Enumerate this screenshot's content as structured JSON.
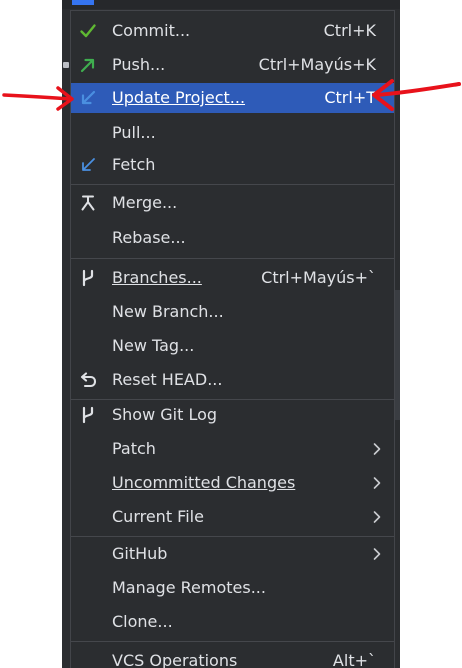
{
  "menu": {
    "items": [
      {
        "label": "Commit...",
        "shortcut": "Ctrl+K",
        "icon": "check-icon"
      },
      {
        "label": "Push...",
        "shortcut": "Ctrl+Mayús+K",
        "icon": "push-arrow-icon"
      },
      {
        "label": "Update Project...",
        "shortcut": "Ctrl+T",
        "icon": "update-arrow-icon",
        "selected": true
      },
      {
        "label": "Pull..."
      },
      {
        "label": "Fetch",
        "icon": "fetch-arrow-icon"
      },
      {
        "label": "Merge...",
        "icon": "merge-icon"
      },
      {
        "label": "Rebase..."
      },
      {
        "label": "Branches...",
        "shortcut": "Ctrl+Mayús+`",
        "icon": "branch-icon"
      },
      {
        "label": "New Branch..."
      },
      {
        "label": "New Tag..."
      },
      {
        "label": "Reset HEAD...",
        "icon": "reset-icon"
      },
      {
        "label": "Show Git Log",
        "icon": "git-log-icon"
      },
      {
        "label": "Patch",
        "submenu": true
      },
      {
        "label": "Uncommitted Changes",
        "submenu": true
      },
      {
        "label": "Current File",
        "submenu": true
      },
      {
        "label": "GitHub",
        "submenu": true
      },
      {
        "label": "Manage Remotes..."
      },
      {
        "label": "Clone..."
      },
      {
        "label": "VCS Operations",
        "shortcut": "Alt+`"
      }
    ]
  },
  "colors": {
    "menu_bg": "#2b2d30",
    "selection": "#2e5bb8",
    "text": "#dfe1e5",
    "check_green": "#5fb832",
    "push_green": "#3fae4f",
    "fetch_blue": "#4a8fe0",
    "annotation_red": "#e8121b"
  }
}
